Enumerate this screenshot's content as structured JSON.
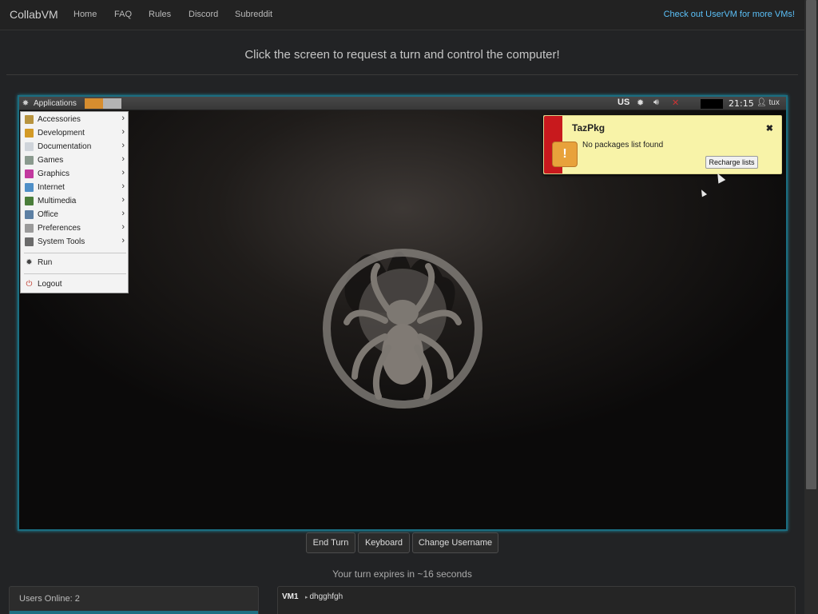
{
  "navbar": {
    "brand": "CollabVM",
    "links": [
      "Home",
      "FAQ",
      "Rules",
      "Discord",
      "Subreddit"
    ],
    "right_link": "Check out UserVM for more VMs!"
  },
  "instructions": "Click the screen to request a turn and control the computer!",
  "vm": {
    "taskbar": {
      "apps_label": "Applications",
      "keyboard_layout": "US",
      "clock": "21:15",
      "user": "tux"
    },
    "menu": {
      "items": [
        {
          "label": "Accessories",
          "icon": "accessories-icon",
          "color": "#b8943f"
        },
        {
          "label": "Development",
          "icon": "development-icon",
          "color": "#d39a26"
        },
        {
          "label": "Documentation",
          "icon": "documentation-icon",
          "color": "#cfd4da"
        },
        {
          "label": "Games",
          "icon": "games-icon",
          "color": "#8a9a8e"
        },
        {
          "label": "Graphics",
          "icon": "graphics-icon",
          "color": "#c2399f"
        },
        {
          "label": "Internet",
          "icon": "internet-icon",
          "color": "#4f8fc7"
        },
        {
          "label": "Multimedia",
          "icon": "multimedia-icon",
          "color": "#4a7d3a"
        },
        {
          "label": "Office",
          "icon": "office-icon",
          "color": "#5c7fa3"
        },
        {
          "label": "Preferences",
          "icon": "preferences-icon",
          "color": "#9a9a9a"
        },
        {
          "label": "System Tools",
          "icon": "system-tools-icon",
          "color": "#6b6b6b"
        }
      ],
      "run": "Run",
      "logout": "Logout"
    },
    "notification": {
      "title": "TazPkg",
      "message": "No packages list found",
      "button": "Recharge lists"
    }
  },
  "controls": {
    "end_turn": "End Turn",
    "keyboard": "Keyboard",
    "change_username": "Change Username"
  },
  "turn_status": "Your turn expires in ~16 seconds",
  "users": {
    "title": "Users Online: 2"
  },
  "chat": {
    "messages": [
      {
        "user": "VM1",
        "text": "dhgghfgh"
      }
    ]
  },
  "colors": {
    "accent": "#5bc0f8",
    "vm_border": "#1b6d80",
    "notify_bg": "#f8f3a8",
    "notify_strip": "#c8191d"
  }
}
